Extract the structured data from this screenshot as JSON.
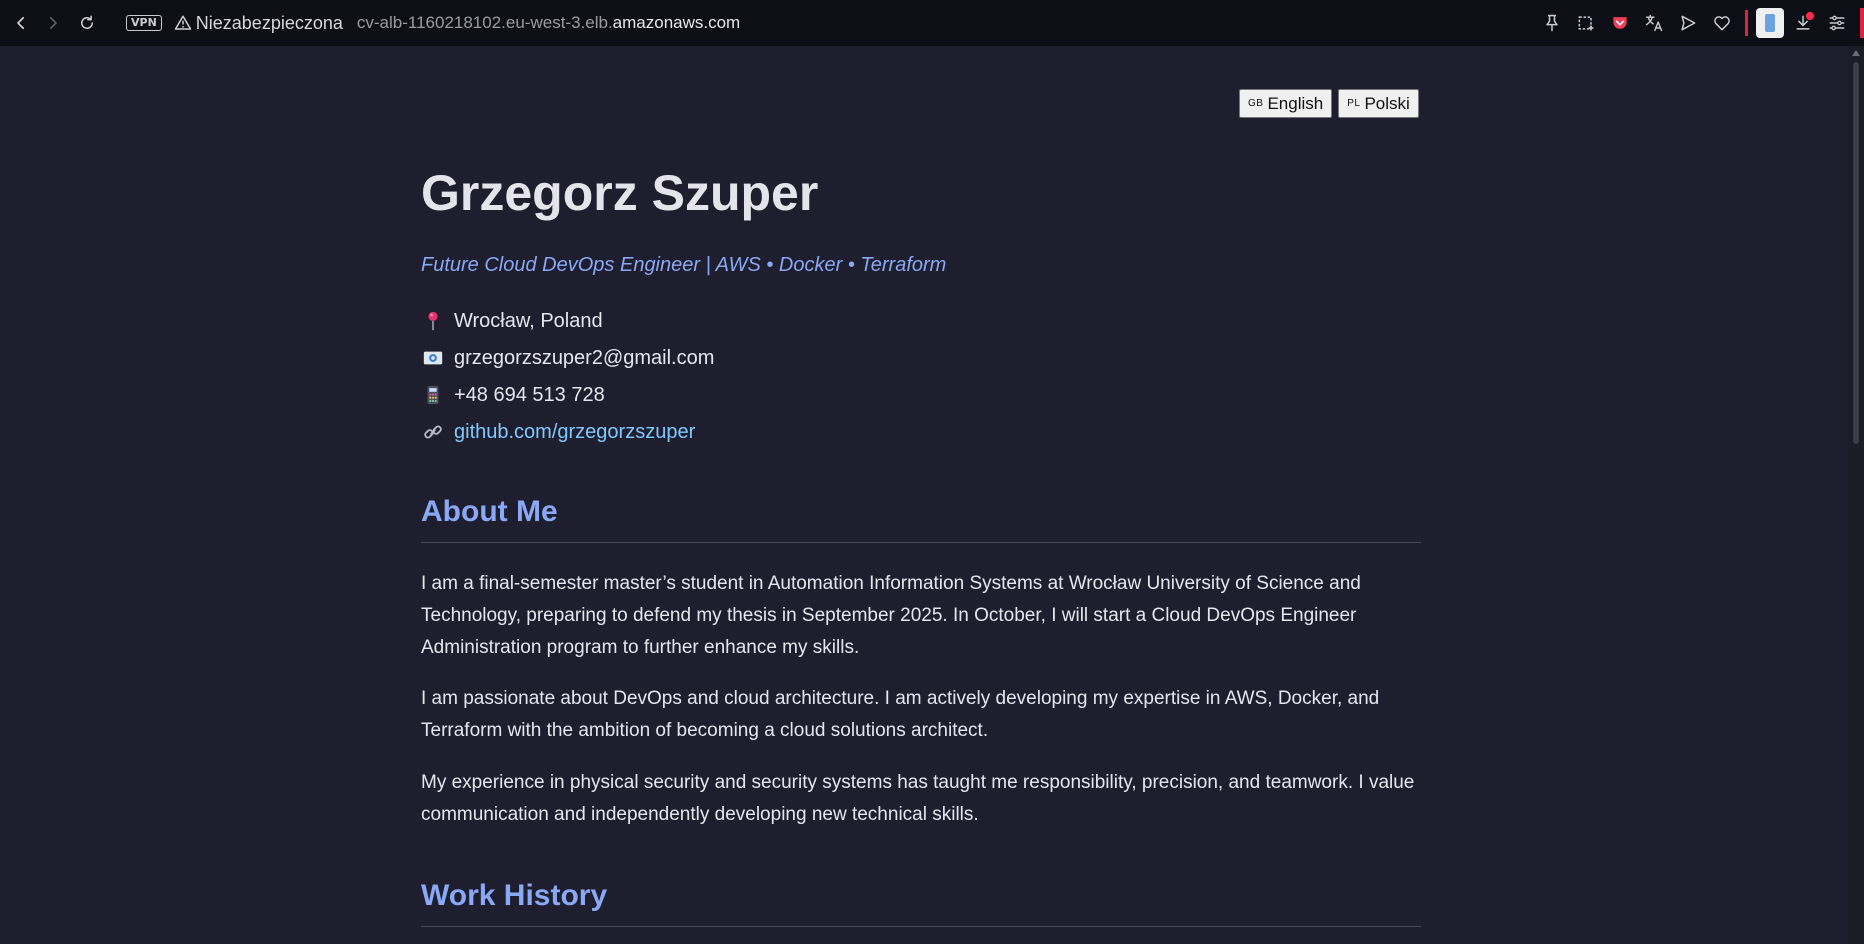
{
  "browser": {
    "vpn_label": "VPN",
    "security_label": "Niezabezpieczona",
    "url_prefix": "cv-alb-1160218102.eu-west-3.elb.",
    "url_domain": "amazonaws.com"
  },
  "language_switch": {
    "english": {
      "flag": "GB",
      "label": "English"
    },
    "polish": {
      "flag": "PL",
      "label": "Polski"
    }
  },
  "profile": {
    "name": "Grzegorz Szuper",
    "tagline": "Future Cloud DevOps Engineer | AWS • Docker • Terraform",
    "location": "Wrocław, Poland",
    "email": "grzegorzszuper2@gmail.com",
    "phone": "+48 694 513 728",
    "github": "github.com/grzegorzszuper"
  },
  "about": {
    "title": "About Me",
    "paragraphs": [
      "I am a final-semester master’s student in Automation Information Systems at Wrocław University of Science and Technology, preparing to defend my thesis in September 2025. In October, I will start a Cloud DevOps Engineer Administration program to further enhance my skills.",
      "I am passionate about DevOps and cloud architecture. I am actively developing my expertise in AWS, Docker, and Terraform with the ambition of becoming a cloud solutions architect.",
      "My experience in physical security and security systems has taught me responsibility, precision, and teamwork. I value communication and independently developing new technical skills."
    ]
  },
  "work_history": {
    "title": "Work History"
  },
  "colors": {
    "page_bg": "#1e1e2e",
    "accent": "#89a8f5",
    "link": "#7fc9ff",
    "text": "#e6e6ee"
  }
}
